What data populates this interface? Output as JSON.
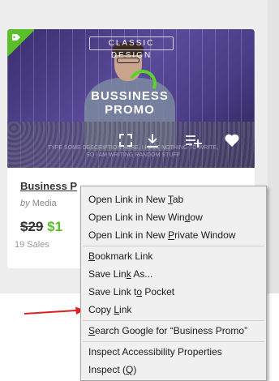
{
  "card": {
    "badge": "CLASSIC DESIGN",
    "promo_title": "BUSSINESS PROMO",
    "fine_print_1": "TYPE SOME DESCRIPTION HERE. I HAVE NOTHING TO WRITE,",
    "fine_print_2": "SO I AM WRITING RANDOM STUFF",
    "title": "Business P",
    "by": "by",
    "author": "Media",
    "price_old": "$29",
    "price_new": "$1",
    "sales": "19 Sales"
  },
  "icons": {
    "ribbon": "tag-icon",
    "fullscreen": "fullscreen-icon",
    "download": "download-icon",
    "add_to_list": "playlist-add-icon",
    "favorite": "heart-icon",
    "pointer": "red-arrow"
  },
  "colors": {
    "ribbon": "#5bbf2a",
    "price_new": "#5bbf2a",
    "arrow": "#e02020",
    "menu_bg": "#f0f0f0"
  },
  "context_menu": {
    "open_new_tab": {
      "before": "Open Link in New ",
      "key": "T",
      "after": "ab"
    },
    "open_new_window": {
      "before": "Open Link in New Win",
      "key": "d",
      "after": "ow"
    },
    "open_private": {
      "before": "Open Link in New ",
      "key": "P",
      "after": "rivate Window"
    },
    "bookmark": {
      "before": "",
      "key": "B",
      "after": "ookmark Link"
    },
    "save_link": {
      "before": "Save Lin",
      "key": "k",
      "after": " As..."
    },
    "save_pocket": {
      "before": "Save Link t",
      "key": "o",
      "after": " Pocket"
    },
    "copy_link": {
      "before": "Copy ",
      "key": "L",
      "after": "ink"
    },
    "search_google": {
      "before": "",
      "key": "S",
      "after": "earch Google for “Business Promo”"
    },
    "inspect_accessibility": {
      "before": "Inspect Accessibility Properties",
      "key": "",
      "after": ""
    },
    "inspect": {
      "before": "Inspect (",
      "key": "Q",
      "after": ")"
    }
  }
}
